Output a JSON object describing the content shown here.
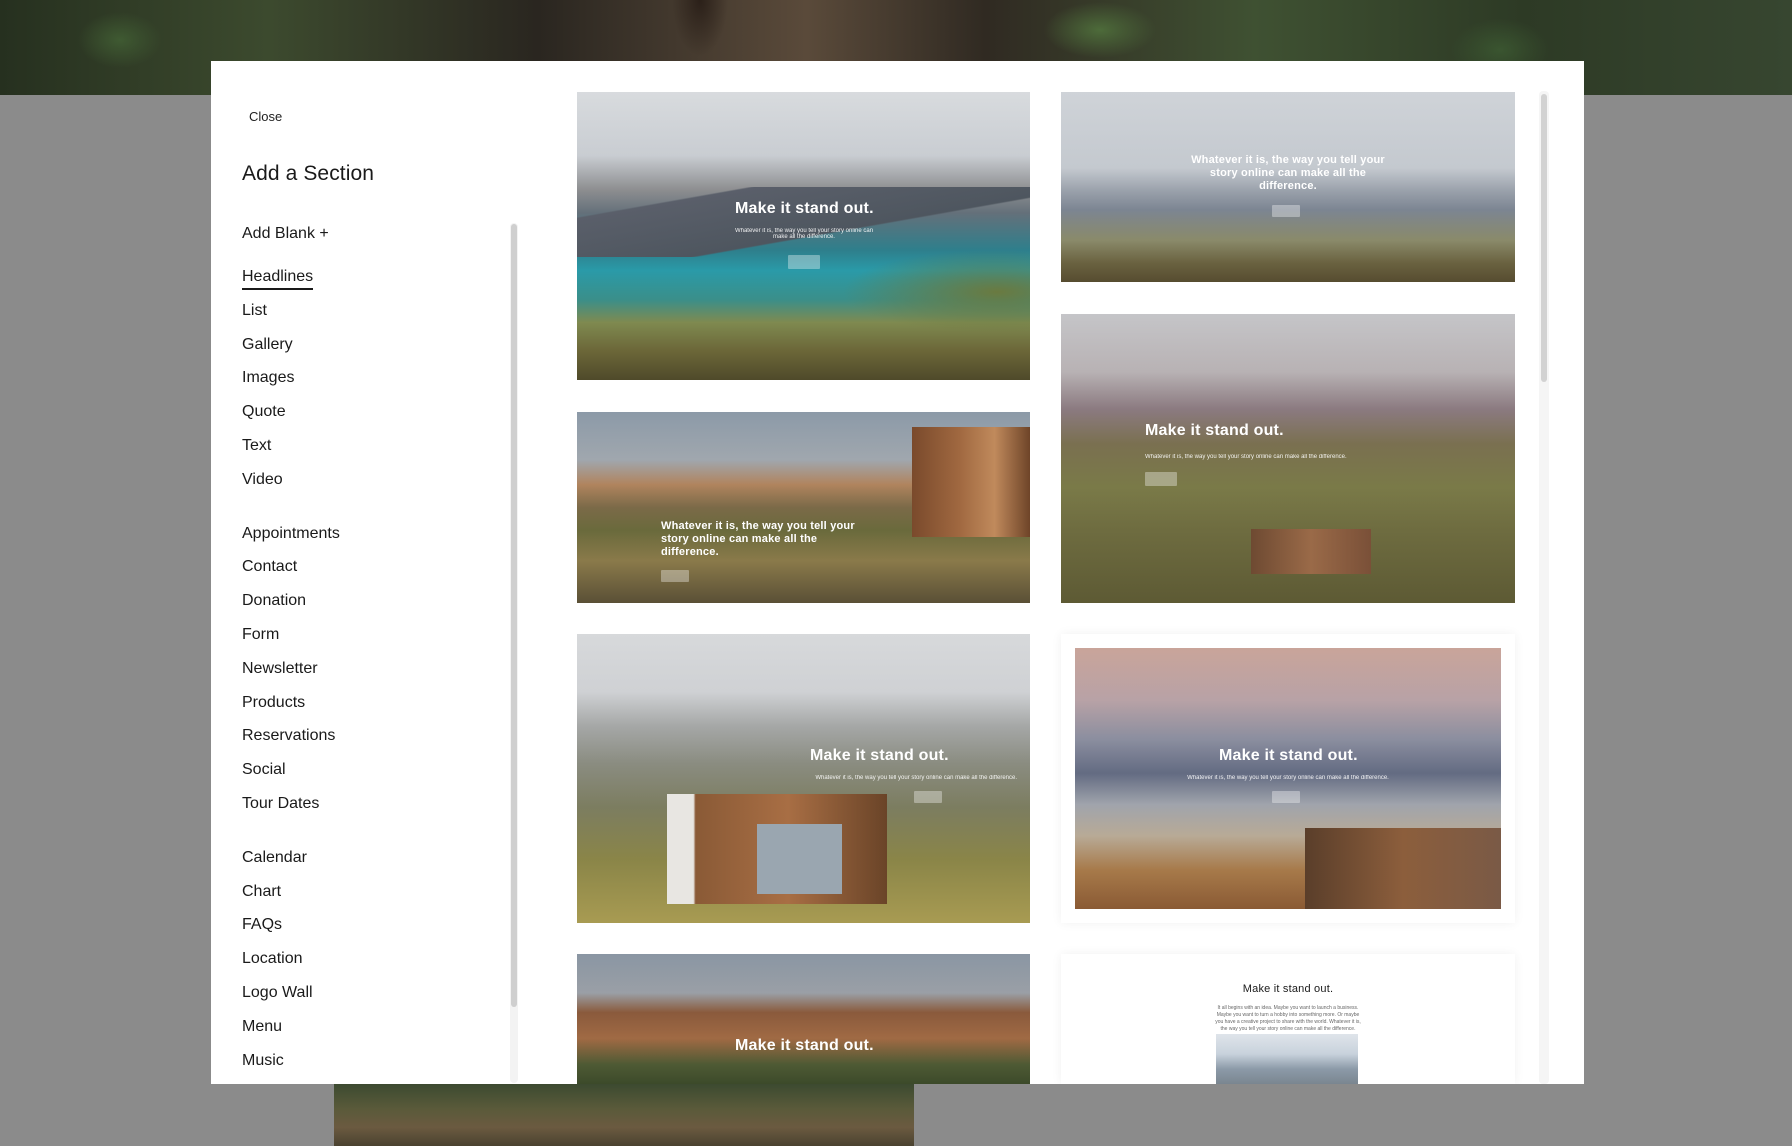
{
  "modal": {
    "close_label": "Close",
    "title": "Add a Section",
    "add_blank_label": "Add Blank +"
  },
  "nav_groups": [
    {
      "items": [
        "Headlines",
        "List",
        "Gallery",
        "Images",
        "Quote",
        "Text",
        "Video"
      ],
      "active": "Headlines"
    },
    {
      "items": [
        "Appointments",
        "Contact",
        "Donation",
        "Form",
        "Newsletter",
        "Products",
        "Reservations",
        "Social",
        "Tour Dates"
      ]
    },
    {
      "items": [
        "Calendar",
        "Chart",
        "FAQs",
        "Location",
        "Logo Wall",
        "Menu",
        "Music"
      ]
    }
  ],
  "cards": {
    "c1": {
      "headline": "Make it stand out.",
      "body": "Whatever it is, the way you tell your story online can make all the difference."
    },
    "c2": {
      "headline": "Whatever it is, the way you tell your story online can make all the difference."
    },
    "c3": {
      "headline": "Whatever it is, the way you tell your story online can make all the difference."
    },
    "c4": {
      "headline": "Make it stand out.",
      "body": "Whatever it is, the way you tell your story online can make all the difference."
    },
    "c5": {
      "headline": "Make it stand out.",
      "body": "Whatever it is, the way you tell your story online can make all the difference."
    },
    "c6": {
      "headline": "Make it stand out.",
      "body": "Whatever it is, the way you tell your story online can make all the difference."
    },
    "c7": {
      "headline": "Make it stand out."
    },
    "c8": {
      "headline": "Make it stand out.",
      "body": "It all begins with an idea. Maybe you want to launch a business. Maybe you want to turn a hobby into something more. Or maybe you have a creative project to share with the world. Whatever it is, the way you tell your story online can make all the difference."
    }
  }
}
